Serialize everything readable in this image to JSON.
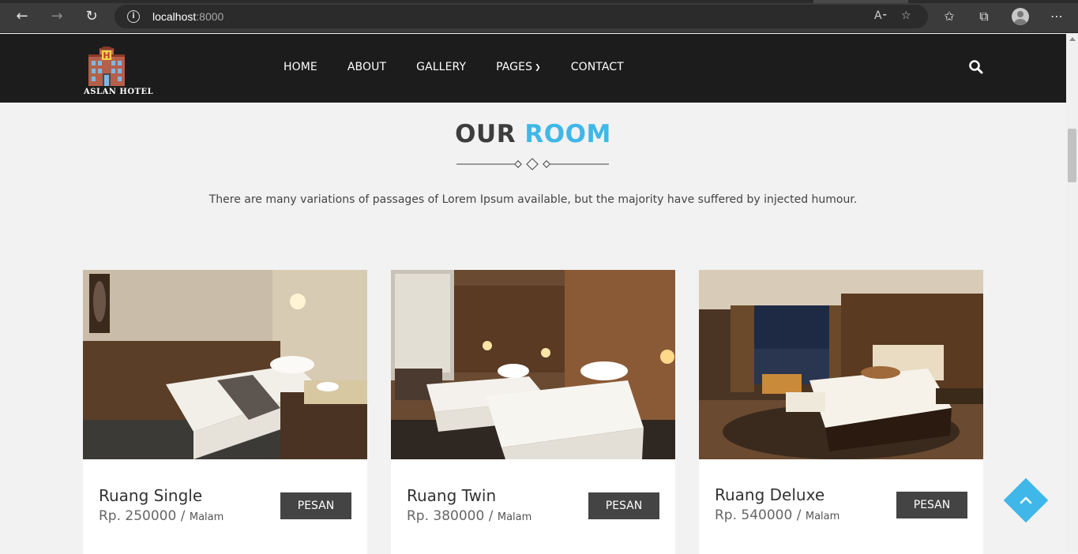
{
  "browser": {
    "url_host": "localhost",
    "url_port": ":8000"
  },
  "site": {
    "logo_text": "ASLAN HOTEL",
    "nav": [
      "HOME",
      "ABOUT",
      "GALLERY",
      "PAGES",
      "CONTACT"
    ]
  },
  "section": {
    "title_dark": "OUR",
    "title_accent": "ROOM",
    "lead": "There are many variations of passages of Lorem Ipsum available, but the majority have suffered by injected humour."
  },
  "rooms": [
    {
      "name": "Ruang Single",
      "price": "Rp. 250000",
      "separator": "/",
      "unit": "Malam",
      "button": "PESAN"
    },
    {
      "name": "Ruang Twin",
      "price": "Rp. 380000",
      "separator": "/",
      "unit": "Malam",
      "button": "PESAN"
    },
    {
      "name": "Ruang Deluxe",
      "price": "Rp. 540000",
      "separator": "/",
      "unit": "Malam",
      "button": "PESAN"
    }
  ],
  "colors": {
    "accent": "#3fb7e8",
    "header_bg": "#1c1c1c",
    "button_bg": "#444444",
    "page_bg": "#f2f2f2"
  },
  "icons": {
    "back": "arrow-left-icon",
    "forward": "arrow-right-icon",
    "reload": "reload-icon",
    "site_info": "info-icon",
    "read_aloud": "read-aloud-icon",
    "add_favorite": "star-plus-icon",
    "favorites": "favorites-icon",
    "collections": "collections-icon",
    "profile": "profile-icon",
    "more": "more-icon",
    "search": "search-icon",
    "back_to_top": "chevron-up-icon"
  }
}
